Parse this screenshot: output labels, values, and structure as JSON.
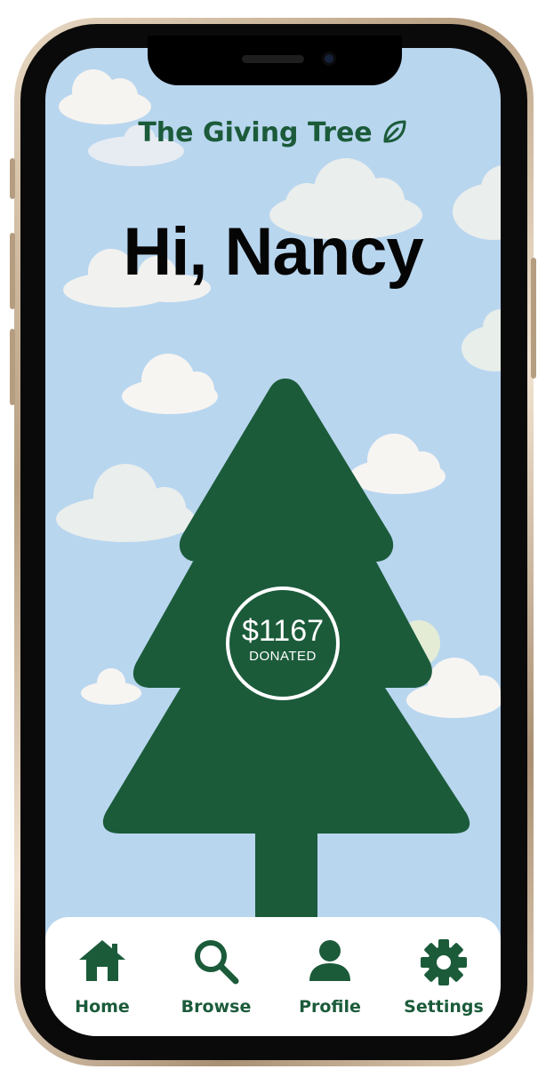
{
  "app": {
    "brand": "The Giving Tree",
    "brand_icon": "leaf-icon"
  },
  "home": {
    "greeting": "Hi, Nancy",
    "donation_amount": "$1167",
    "donation_label": "DONATED"
  },
  "colors": {
    "brand_green": "#1b5b3a",
    "sky": "#b9d6ef",
    "cloud": "#f3f1ec",
    "nav_background": "#ffffff"
  },
  "nav": {
    "active": "Home",
    "items": [
      {
        "label": "Home",
        "icon": "home-icon"
      },
      {
        "label": "Browse",
        "icon": "search-icon"
      },
      {
        "label": "Profile",
        "icon": "user-icon"
      },
      {
        "label": "Settings",
        "icon": "gear-icon"
      }
    ]
  }
}
